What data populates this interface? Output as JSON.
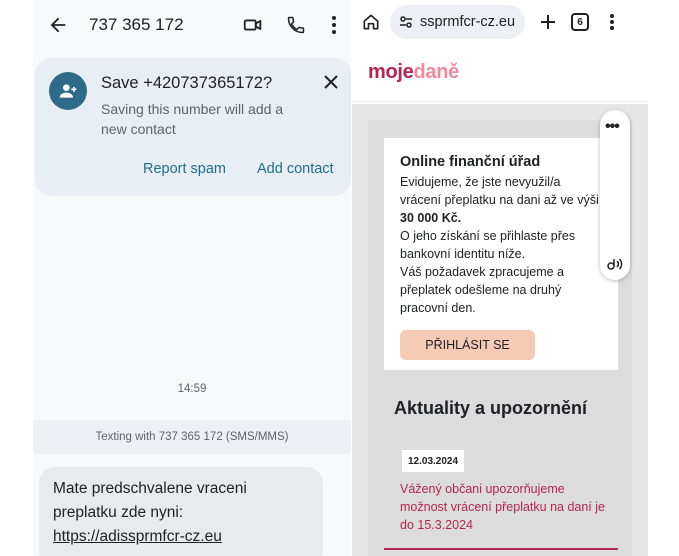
{
  "sms": {
    "phone_number": "737 365 172",
    "save_card": {
      "title": "Save +420737365172?",
      "subtitle": "Saving this number will add a new contact",
      "report_label": "Report spam",
      "add_label": "Add contact"
    },
    "time": "14:59",
    "texting_info": "Texting with 737 365 172 (SMS/MMS)",
    "message": {
      "line1": "Mate predschvalene vraceni",
      "line2": "preplatku zde nyni:",
      "link": "https://adissprmfcr-cz.eu"
    }
  },
  "browser": {
    "url": "ssprmfcr-cz.eu",
    "tab_count": "6",
    "logo_moje": "moje",
    "logo_dane": "daně",
    "card": {
      "title": "Online finanční úřad",
      "body_line1": "Evidujeme, že jste nevyužil/a vrácení přeplatku na dani až ve výši ",
      "amount": "30 000 Kč.",
      "body_line2": "O jeho získání se přihlaste přes bankovní identitu níže.",
      "body_line3": "Váš požadavek zpracujeme a přeplatek odešleme na druhý pracovní den.",
      "login_label": "PŘIHLÁSIT SE"
    },
    "news": {
      "title": "Aktuality a upozornění",
      "date": "12.03.2024",
      "text": "Vážený občani upozorňujeme možnost vrácení přeplatku na daní je do 15.3.2024"
    },
    "colors": {
      "brand": "#b5264e",
      "brand_light": "#f08a9c",
      "login_button": "#f6cbb6"
    }
  },
  "icons": [
    "back-arrow-icon",
    "video-call-icon",
    "phone-icon",
    "more-vert-icon",
    "add-person-icon",
    "close-icon",
    "home-icon",
    "site-settings-icon",
    "new-tab-icon",
    "tabs-icon",
    "speaker-icon"
  ]
}
